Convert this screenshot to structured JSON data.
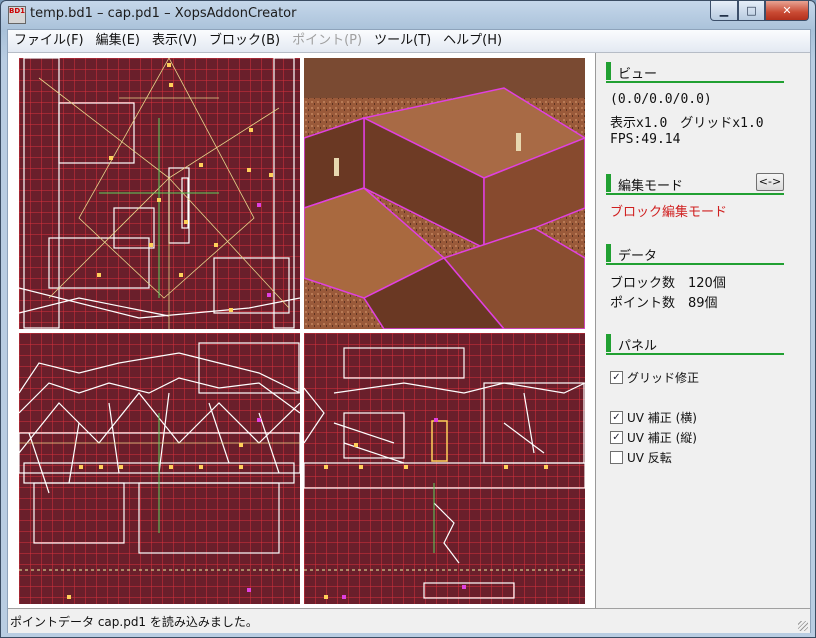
{
  "window": {
    "title": "temp.bd1 – cap.pd1 – XopsAddonCreator",
    "icon_text": "BD1",
    "min_glyph": "▁",
    "max_glyph": "□",
    "close_glyph": "✕"
  },
  "menu": [
    {
      "label": "ファイル(F)",
      "enabled": true
    },
    {
      "label": "編集(E)",
      "enabled": true
    },
    {
      "label": "表示(V)",
      "enabled": true
    },
    {
      "label": "ブロック(B)",
      "enabled": true
    },
    {
      "label": "ポイント(P)",
      "enabled": false
    },
    {
      "label": "ツール(T)",
      "enabled": true
    },
    {
      "label": "ヘルプ(H)",
      "enabled": true
    }
  ],
  "panel": {
    "view": {
      "heading": "ビュー",
      "camera": "(0.0/0.0/0.0)",
      "zoom_grid": "表示x1.0　グリッドx1.0",
      "fps": "FPS:49.14"
    },
    "edit_mode": {
      "heading": "編集モード",
      "toggle": "<->",
      "mode": "ブロック編集モード"
    },
    "data": {
      "heading": "データ",
      "blocks": "ブロック数　120個",
      "points": "ポイント数　89個"
    },
    "panel_opts": {
      "heading": "パネル",
      "grid_fix": {
        "label": "グリッド修正",
        "checked": true
      },
      "uv_h": {
        "label": "UV 補正 (横)",
        "checked": true
      },
      "uv_v": {
        "label": "UV 補正 (縦)",
        "checked": true
      },
      "uv_flip": {
        "label": "UV 反転",
        "checked": false
      }
    }
  },
  "status": {
    "message": "ポイントデータ cap.pd1 を読み込みました。"
  },
  "colors": {
    "grid_bg": "#6a1f2b",
    "grid_line": "#d8323c",
    "accent_green": "#21a032",
    "mode_red": "#d02020"
  }
}
